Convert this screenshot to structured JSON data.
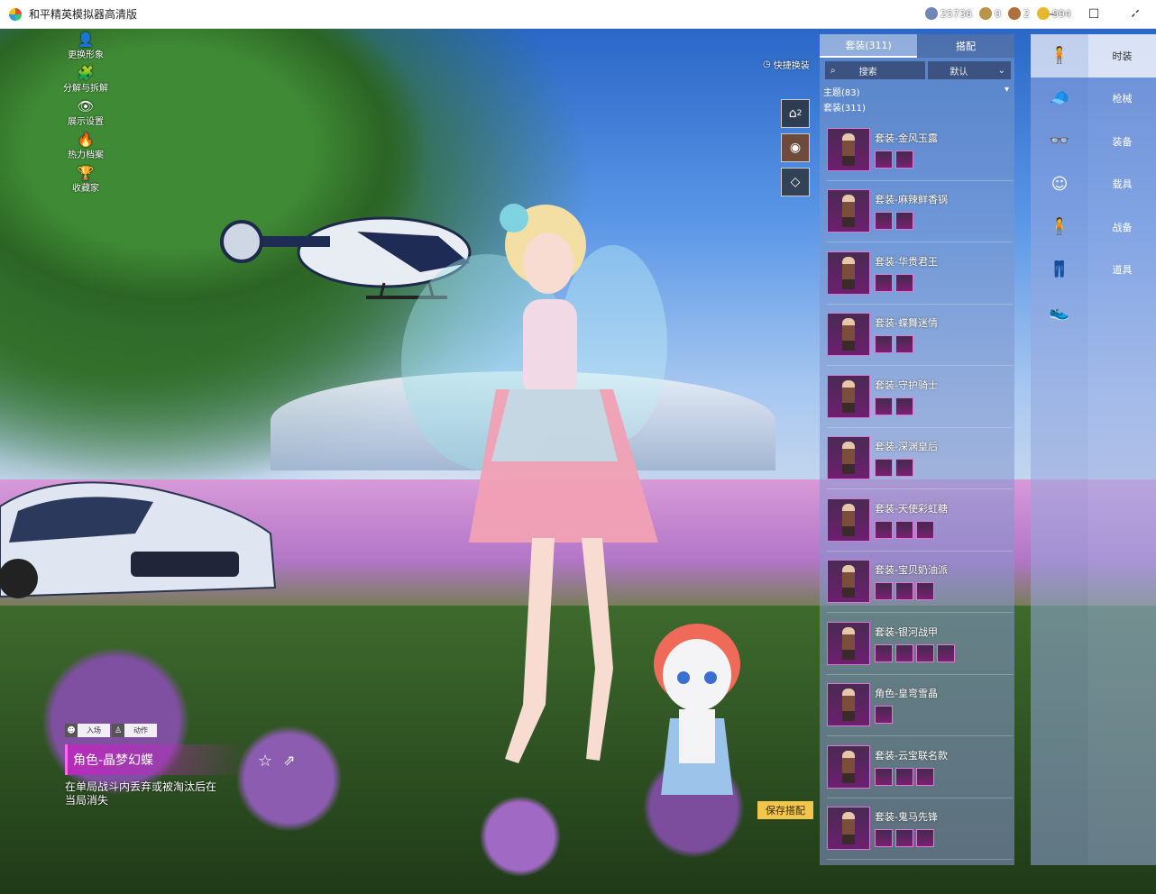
{
  "window": {
    "title": "和平精英模拟器高清版",
    "controls": {
      "minimize": "—",
      "maximize": "☐",
      "close": "✕"
    }
  },
  "currency": [
    {
      "icon": "globe-coin-icon",
      "value": "25736",
      "color": "#6f86b8"
    },
    {
      "icon": "badge-coin-icon",
      "value": "0",
      "color": "#b89548"
    },
    {
      "icon": "medal-coin-icon",
      "value": "2",
      "color": "#b0703a"
    },
    {
      "icon": "gold-coin-icon",
      "value": "994",
      "color": "#e6b832"
    }
  ],
  "close_glyph": "✕",
  "left_menu": [
    {
      "icon": "person-icon",
      "glyph": "👤",
      "label": "更换形象"
    },
    {
      "icon": "puzzle-icon",
      "glyph": "🧩",
      "label": "分解与拆解"
    },
    {
      "icon": "eye-icon",
      "glyph": "👁",
      "label": "展示设置"
    },
    {
      "icon": "flame-icon",
      "glyph": "🔥",
      "label": "热力档案"
    },
    {
      "icon": "trophy-icon",
      "glyph": "🏆",
      "label": "收藏家"
    }
  ],
  "quick_change": {
    "label": "快捷换装",
    "hanger_badge": "2"
  },
  "panel": {
    "tabs": [
      {
        "label": "套装(311)",
        "active": true
      },
      {
        "label": "搭配",
        "active": false
      }
    ],
    "search_label": "搜索",
    "sort_label": "默认",
    "groups": [
      "主题(83)",
      "套装(311)"
    ],
    "items": [
      {
        "name": "套装-金风玉露",
        "subs": 2
      },
      {
        "name": "套装-麻辣鲜香锅",
        "subs": 2
      },
      {
        "name": "套装-华贵君王",
        "subs": 2
      },
      {
        "name": "套装-蝶舞迷情",
        "subs": 2
      },
      {
        "name": "套装-守护骑士",
        "subs": 2
      },
      {
        "name": "套装-深渊皇后",
        "subs": 2
      },
      {
        "name": "套装-天使彩虹糖",
        "subs": 3
      },
      {
        "name": "套装-宝贝奶油派",
        "subs": 3
      },
      {
        "name": "套装-银河战甲",
        "subs": 4
      },
      {
        "name": "角色-皇弯雪晶",
        "subs": 1
      },
      {
        "name": "套装-云宝联名款",
        "subs": 3
      },
      {
        "name": "套装-鬼马先锋",
        "subs": 3
      }
    ]
  },
  "categories": [
    {
      "icon": "character-icon",
      "glyph": "🧍",
      "label": "时装",
      "active": true
    },
    {
      "icon": "cap-icon",
      "glyph": "🧢",
      "label": "枪械",
      "active": false
    },
    {
      "icon": "goggles-icon",
      "glyph": "👓",
      "label": "装备",
      "active": false
    },
    {
      "icon": "face-icon",
      "glyph": "☺",
      "label": "载具",
      "active": false
    },
    {
      "icon": "outfit-icon",
      "glyph": "🧍",
      "label": "战备",
      "active": false
    },
    {
      "icon": "pants-icon",
      "glyph": "👖",
      "label": "道具",
      "active": false
    },
    {
      "icon": "shoes-icon",
      "glyph": "👟",
      "label": "",
      "active": false
    }
  ],
  "actions": [
    {
      "icon": "smile-icon",
      "glyph": "☻",
      "label": "入场"
    },
    {
      "icon": "pose-icon",
      "glyph": "♙",
      "label": "动作"
    }
  ],
  "character": {
    "name": "角色-晶梦幻蝶",
    "description": "在单局战斗内丢弃或被淘汰后在当局消失"
  },
  "save_label": "保存搭配"
}
